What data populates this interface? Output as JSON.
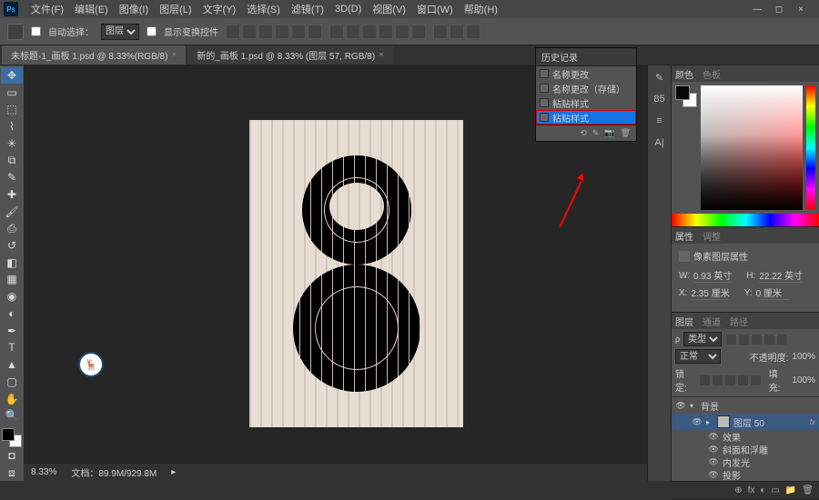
{
  "menu": {
    "logo": "Ps",
    "items": [
      "文件(F)",
      "编辑(E)",
      "图像(I)",
      "图层(L)",
      "文字(Y)",
      "选择(S)",
      "滤镜(T)",
      "3D(D)",
      "视图(V)",
      "窗口(W)",
      "帮助(H)"
    ]
  },
  "window_controls": {
    "min": "—",
    "restore": "◻",
    "close": "×"
  },
  "options": {
    "auto_select_label": "自动选择：",
    "dropdown": "图层",
    "show_transform": "显示变换控件"
  },
  "tabs": [
    {
      "label": "未标题-1_画板 1.psd @ 8.33%(RGB/8)",
      "close": "×",
      "active": true
    },
    {
      "label": "新的_画板 1.psd @ 8.33% (图层 57, RGB/8)",
      "close": "×",
      "active": false
    }
  ],
  "history": {
    "title": "历史记录",
    "rows": [
      "名称更改",
      "名称更改（存储）",
      "粘贴样式",
      "粘贴样式"
    ],
    "footer_icons": [
      "⟲",
      "✎",
      "📷",
      "🗑"
    ]
  },
  "panel_strip_icons": [
    "✎",
    "85",
    "≡",
    "A|"
  ],
  "color_panel": {
    "tab1": "颜色",
    "tab2": "色板"
  },
  "properties_panel": {
    "tab1": "属性",
    "tab2": "调整",
    "title": "像素图层属性",
    "w_label": "W:",
    "w_val": "0.93 英寸",
    "h_label": "H:",
    "h_val": "22.22 英寸",
    "x_label": "X:",
    "x_val": "2.35 厘米",
    "y_label": "Y:",
    "y_val": "0 厘米"
  },
  "layers_panel": {
    "tabs": [
      "图层",
      "通道",
      "路径"
    ],
    "kind": "类型",
    "blend": "正常",
    "opacity_label": "不透明度:",
    "opacity": "100%",
    "lock_label": "锁定:",
    "fill_label": "填充:",
    "fill": "100%",
    "rows": [
      {
        "eye": "👁",
        "arrow": "▾",
        "name": "背景",
        "thumb": false,
        "indent": 0
      },
      {
        "eye": "👁",
        "arrow": "▸",
        "name": "图层 50",
        "thumb": true,
        "selected": true,
        "fx": "fx",
        "indent": 1
      },
      {
        "eye": "👁",
        "name": "效果",
        "effect": true,
        "indent": 2
      },
      {
        "eye": "👁",
        "name": "斜面和浮雕",
        "effect": true,
        "indent": 2
      },
      {
        "eye": "👁",
        "name": "内发光",
        "effect": true,
        "indent": 2
      },
      {
        "eye": "👁",
        "name": "投影",
        "effect": true,
        "indent": 2
      }
    ],
    "footer_icons": [
      "⊕",
      "fx",
      "◐",
      "▭",
      "📁",
      "🗑"
    ]
  },
  "zoom": "8.33%",
  "doc_info": "文档：89.9M/929.8M",
  "watermark_text": "🦌"
}
